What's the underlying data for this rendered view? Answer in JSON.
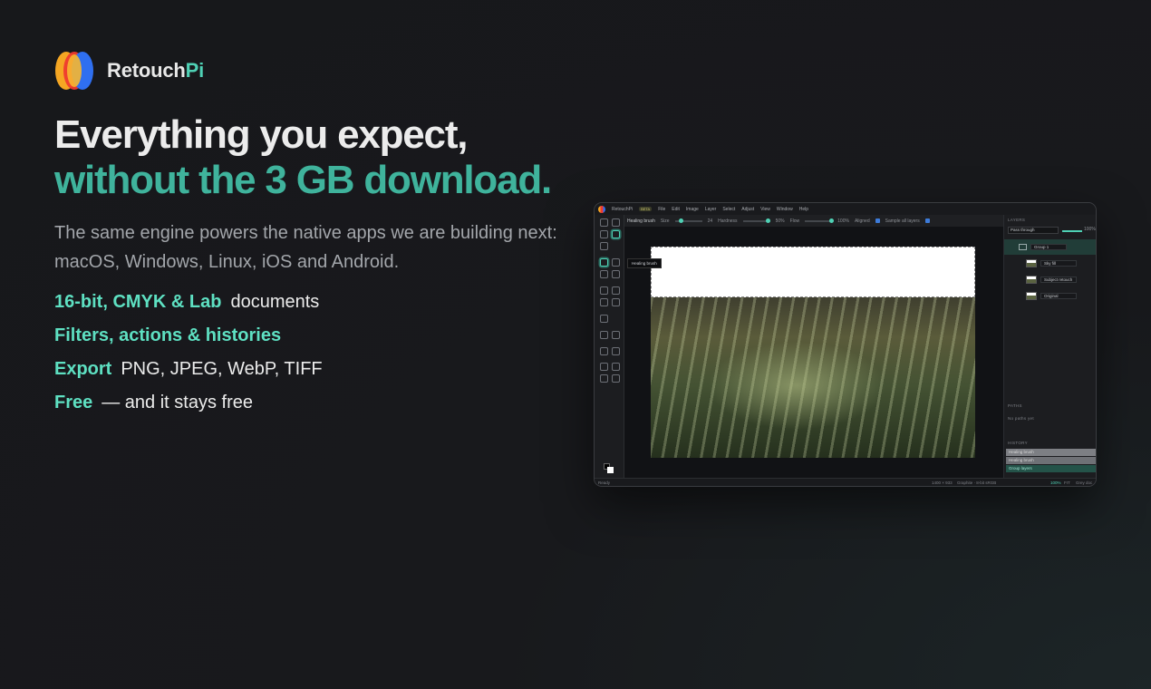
{
  "brand": {
    "name_main": "Retouch",
    "name_accent": "Pi"
  },
  "headline": {
    "line1": "Everything you expect,",
    "line2": "without the 3 GB download."
  },
  "subtitle": "The same engine powers the native apps we are building next: macOS, Windows, Linux, iOS and Android.",
  "features": [
    {
      "highlight": "16-bit, CMYK & Lab",
      "rest": "documents"
    },
    {
      "highlight": "Filters, actions & histories",
      "rest": ""
    },
    {
      "highlight": "Export",
      "rest": "PNG, JPEG, WebP, TIFF"
    },
    {
      "highlight": "Free",
      "rest": "— and it stays free"
    }
  ],
  "app": {
    "title": "RetouchPi",
    "badge": "BETA",
    "menus": [
      "File",
      "Edit",
      "Image",
      "Layer",
      "Select",
      "Adjust",
      "View",
      "Window",
      "Help"
    ],
    "options": {
      "tool": "Healing brush",
      "size_label": "Size",
      "size_value": "24",
      "hardness_label": "Hardness",
      "hardness_value": "50%",
      "flow_label": "Flow",
      "flow_value": "100%",
      "aligned_label": "Aligned",
      "sample_label": "Sample all layers"
    },
    "tooltip": "Healing brush",
    "layers_header": "LAYERS",
    "blend_mode": "Pass through",
    "opacity": "100%",
    "layers": [
      "Group 1",
      "Sky fill",
      "Subject retouch",
      "Original"
    ],
    "paths_header": "PATHS",
    "paths_empty": "No paths yet",
    "history_header": "HISTORY",
    "history": [
      "Healing brush",
      "Healing brush",
      "Group layers"
    ],
    "status": {
      "left": "Ready",
      "size": "1400 × 933",
      "mode": "Graphite · 8-bit sRGB",
      "zoom": "100%",
      "fit": "FIT",
      "hint": "Grey doc"
    },
    "colors": {
      "accent": "#4fd1b5",
      "selected_layer": "#213d38"
    }
  }
}
